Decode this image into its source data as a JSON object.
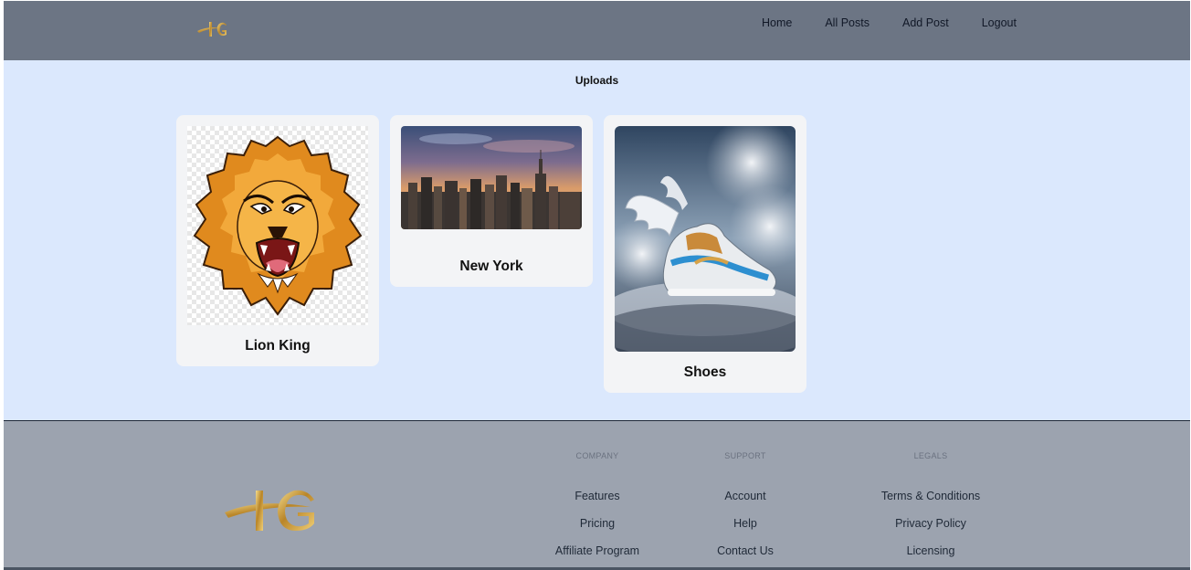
{
  "header": {
    "logo_icon": "hg-monogram-logo",
    "nav": [
      {
        "label": "Home"
      },
      {
        "label": "All Posts"
      },
      {
        "label": "Add Post"
      },
      {
        "label": "Logout"
      }
    ]
  },
  "main": {
    "title": "Uploads",
    "posts": [
      {
        "title": "Lion King",
        "image": "lion-illustration"
      },
      {
        "title": "New York",
        "image": "city-skyline-photo"
      },
      {
        "title": "Shoes",
        "image": "winged-sneaker-photo"
      }
    ]
  },
  "footer": {
    "logo_icon": "hg-monogram-logo",
    "columns": [
      {
        "heading": "COMPANY",
        "links": [
          "Features",
          "Pricing",
          "Affiliate Program"
        ]
      },
      {
        "heading": "SUPPORT",
        "links": [
          "Account",
          "Help",
          "Contact Us"
        ]
      },
      {
        "heading": "LEGALS",
        "links": [
          "Terms & Conditions",
          "Privacy Policy",
          "Licensing"
        ]
      }
    ]
  },
  "colors": {
    "header_bg": "#6c7584",
    "page_bg": "#dbe8fd",
    "card_bg": "#f3f4f6",
    "footer_bg": "#9ca3af",
    "logo_gold": "#c9a24a"
  }
}
